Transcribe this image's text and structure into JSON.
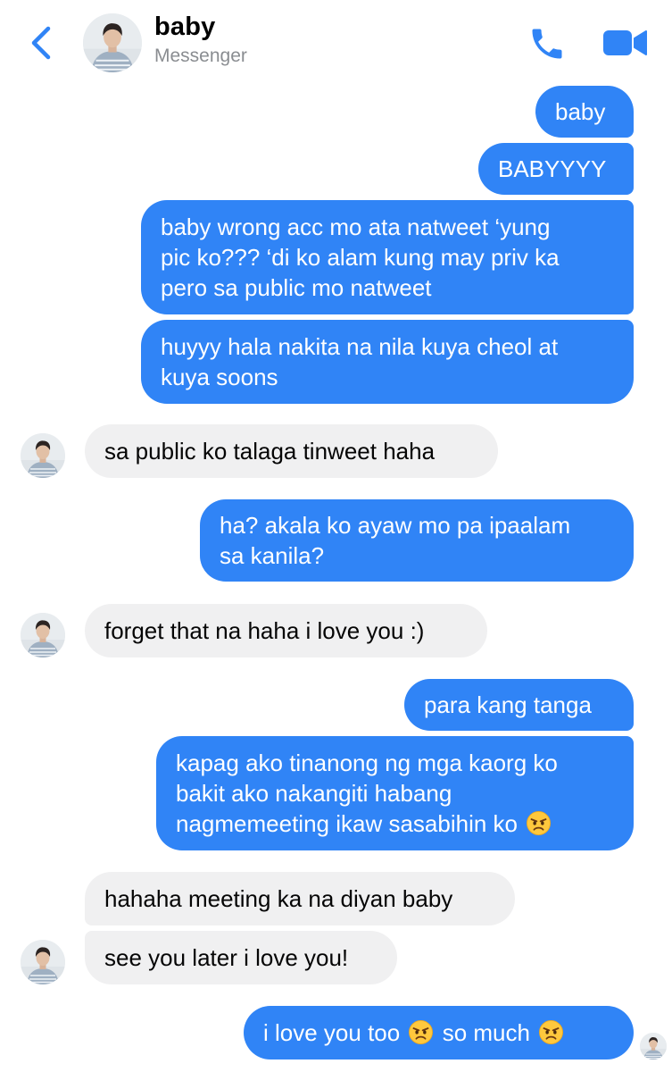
{
  "header": {
    "title": "baby",
    "subtitle": "Messenger",
    "back_icon": "chevron-left-icon",
    "call_icon": "phone-icon",
    "video_icon": "video-camera-icon",
    "accent_color": "#3084f6"
  },
  "messages": [
    {
      "sender": "me",
      "text": "baby"
    },
    {
      "sender": "me",
      "text": "BABYYYY"
    },
    {
      "sender": "me",
      "line1": "baby wrong acc mo ata natweet ‘yung",
      "line2": "pic ko??? ‘di ko alam kung may priv ka",
      "line3": "pero sa public mo natweet"
    },
    {
      "sender": "me",
      "line1": "huyyy hala nakita na nila kuya cheol at",
      "line2": "kuya soons"
    },
    {
      "sender": "them",
      "text": "sa public ko talaga tinweet haha"
    },
    {
      "sender": "me",
      "line1": "ha? akala ko ayaw mo pa ipaalam",
      "line2": "sa kanila?"
    },
    {
      "sender": "them",
      "text": "forget that na haha i love you :)"
    },
    {
      "sender": "me",
      "text": "para kang tanga"
    },
    {
      "sender": "me",
      "line1": "kapag ako tinanong ng mga kaorg ko",
      "line2": "bakit ako nakangiti habang",
      "line3": "nagmemeeting ikaw sasabihin ko",
      "emoji": "angry-face-emoji"
    },
    {
      "sender": "them",
      "text": "hahaha meeting ka na diyan baby"
    },
    {
      "sender": "them",
      "text": "see you later i love you!"
    },
    {
      "sender": "me",
      "part1": "i love you too",
      "part2": "so much",
      "emoji": "angry-face-emoji"
    }
  ],
  "colors": {
    "outgoing_bubble": "#3084f6",
    "incoming_bubble": "#f0f0f1",
    "subtitle": "#8a8d91"
  }
}
